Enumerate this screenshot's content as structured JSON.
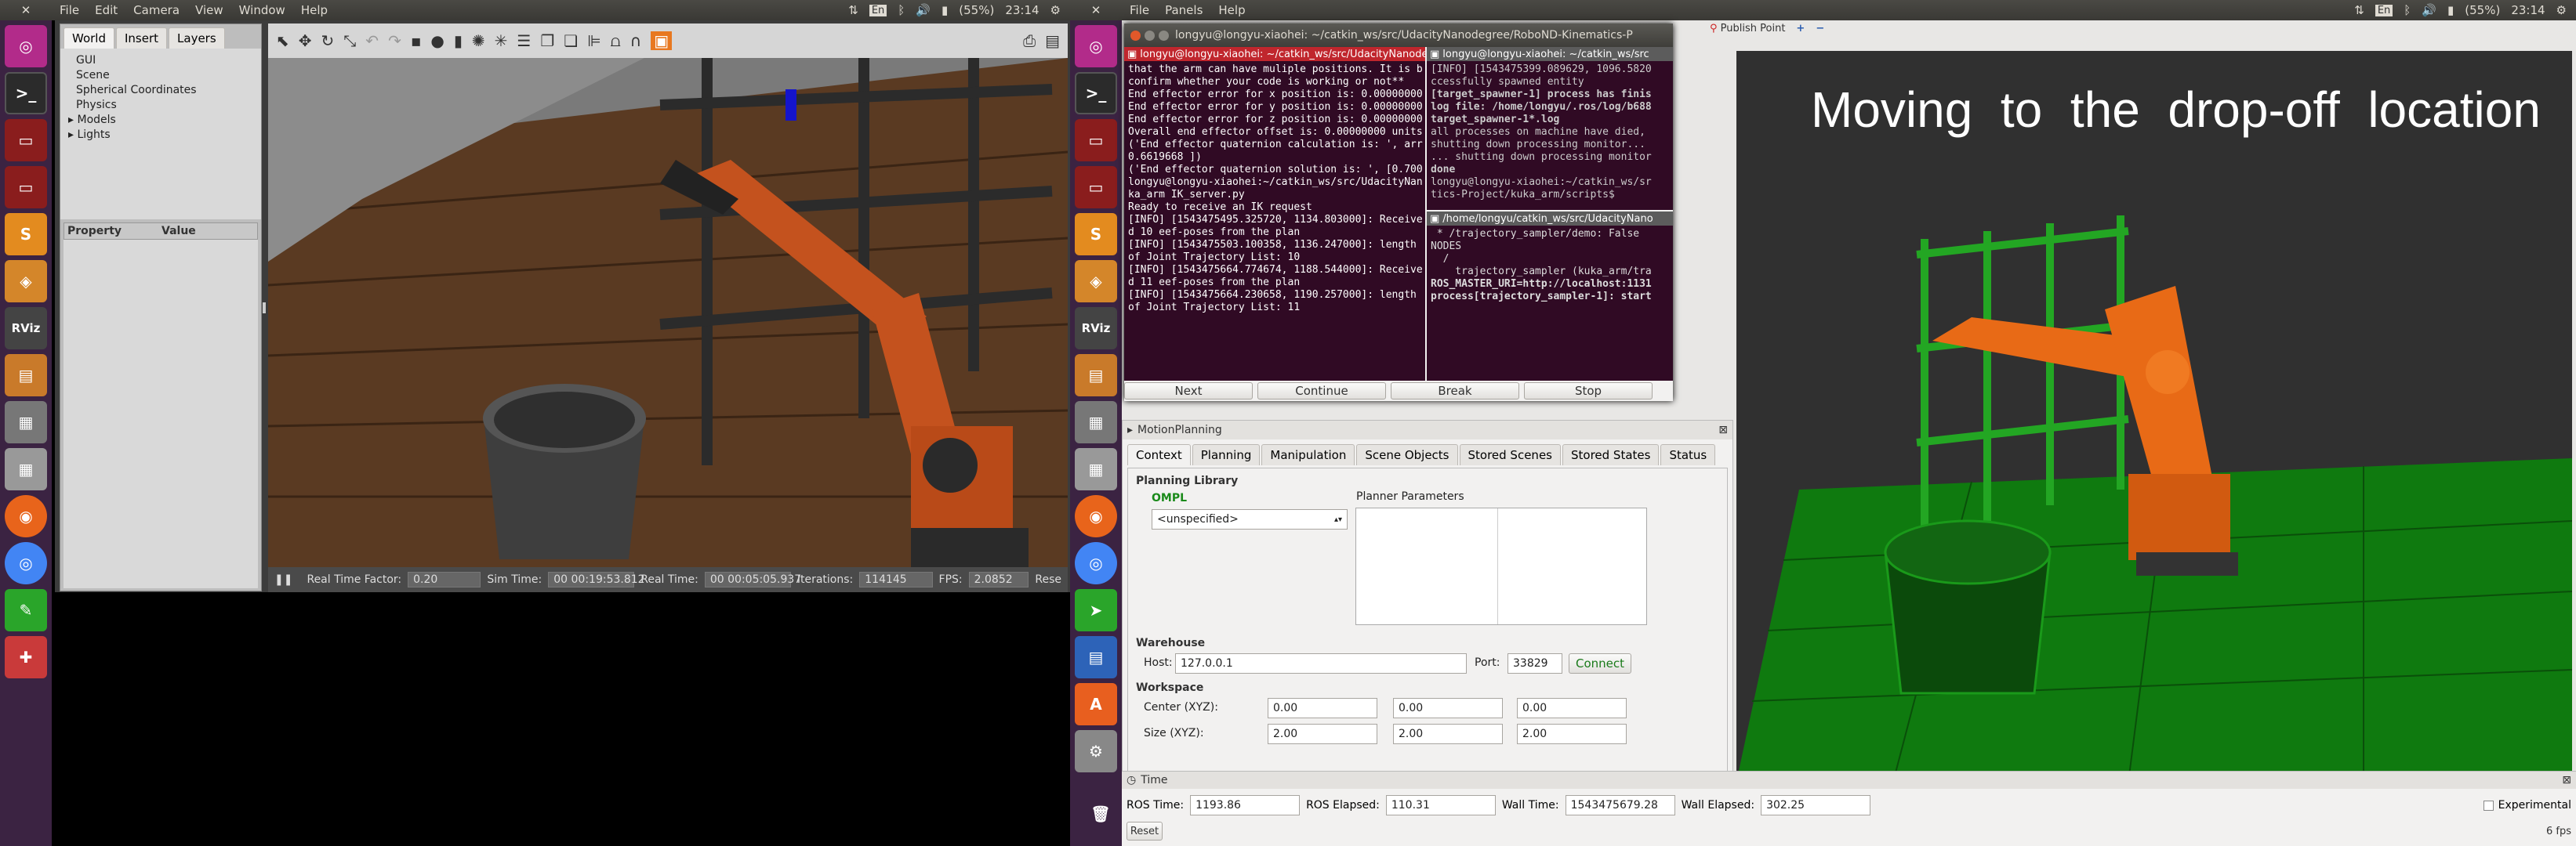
{
  "left_menubar": {
    "items": [
      "File",
      "Edit",
      "Camera",
      "View",
      "Window",
      "Help"
    ],
    "battery": "(55%)",
    "clock": "23:14",
    "kbd": "En"
  },
  "right_menubar": {
    "items": [
      "File",
      "Panels",
      "Help"
    ],
    "battery": "(55%)",
    "clock": "23:14",
    "kbd": "En"
  },
  "gazebo": {
    "tabs": [
      "World",
      "Insert",
      "Layers"
    ],
    "tree": [
      "GUI",
      "Scene",
      "Spherical Coordinates",
      "Physics",
      "Models",
      "Lights"
    ],
    "prop_header": "Property",
    "value_header": "Value",
    "status": {
      "rtf_label": "Real Time Factor:",
      "rtf": "0.20",
      "sim_label": "Sim Time:",
      "sim": "00 00:19:53.812",
      "real_label": "Real Time:",
      "real": "00 00:05:05.937",
      "iter_label": "Iterations:",
      "iter": "114145",
      "fps_label": "FPS:",
      "fps": "2.0852",
      "reset": "Rese"
    }
  },
  "terminal_main": {
    "title": "longyu@longyu-xiaohei: ~/catkin_ws/src/UdacityNanodegree/RoboND-Kinematics-P",
    "tab_title": "longyu@longyu-xiaohei: ~/catkin_ws/src/UdacityNanode",
    "lines": [
      "that the arm can have muliple positions. It is b",
      "",
      "confirm whether your code is working or not**",
      "",
      "",
      "End effector error for x position is: 0.00000000",
      "End effector error for y position is: 0.00000000",
      "End effector error for z position is: 0.00000000",
      "Overall end effector offset is: 0.00000000 units",
      "",
      "('End effector quaternion calculation is: ', arr",
      "0.6619668 ])",
      "('End effector quaternion solution is: ', [0.700",
      "longyu@longyu-xiaohei:~/catkin_ws/src/UdacityNan",
      "ka_arm IK_server.py",
      "Ready to receive an IK request",
      "[INFO] [1543475495.325720, 1134.803000]: Receive",
      "d 10 eef-poses from the plan",
      "[INFO] [1543475503.100358, 1136.247000]: length",
      "of Joint Trajectory List: 10",
      "[INFO] [1543475664.774674, 1188.544000]: Receive",
      "d 11 eef-poses from the plan",
      "[INFO] [1543475664.230658, 1190.257000]: length",
      "of Joint Trajectory List: 11"
    ]
  },
  "terminal_tr": {
    "title": "longyu@longyu-xiaohei: ~/catkin_ws/src",
    "lines": [
      "[INFO] [1543475399.089629, 1096.5820",
      "ccessfully spawned entity",
      "[target_spawner-1] process has finis",
      "log file: /home/longyu/.ros/log/b688",
      "target_spawner-1*.log",
      "all processes on machine have died,",
      "shutting down processing monitor...",
      "... shutting down processing monitor",
      "done",
      "longyu@longyu-xiaohei:~/catkin_ws/sr",
      "tics-Project/kuka_arm/scripts$"
    ]
  },
  "terminal_br": {
    "title": "/home/longyu/catkin_ws/src/UdacityNano",
    "lines": [
      " * /trajectory_sampler/demo: False",
      "",
      "NODES",
      "  /",
      "    trajectory_sampler (kuka_arm/tra",
      "",
      "ROS_MASTER_URI=http://localhost:1131",
      "",
      "process[trajectory_sampler-1]: start"
    ]
  },
  "control_buttons": [
    "Next",
    "Continue",
    "Break",
    "Stop"
  ],
  "rviz_toolbar": {
    "publish": "Publish Point",
    "plus": "+",
    "minus": "−"
  },
  "motion": {
    "title": "MotionPlanning",
    "tabs": [
      "Context",
      "Planning",
      "Manipulation",
      "Scene Objects",
      "Stored Scenes",
      "Stored States",
      "Status"
    ],
    "planning_library": "Planning Library",
    "ompl": "OMPL",
    "planner": "<unspecified>",
    "planner_params": "Planner Parameters",
    "warehouse": "Warehouse",
    "host_label": "Host:",
    "host": "127.0.0.1",
    "port_label": "Port:",
    "port": "33829",
    "connect": "Connect",
    "workspace": "Workspace",
    "center_label": "Center (XYZ):",
    "center": [
      "0.00",
      "0.00",
      "0.00"
    ],
    "size_label": "Size (XYZ):",
    "size": [
      "2.00",
      "2.00",
      "2.00"
    ]
  },
  "viewport_text": "Moving  to  the  drop-off  location",
  "time": {
    "title": "Time",
    "ros_time_label": "ROS Time:",
    "ros_time": "1193.86",
    "ros_elapsed_label": "ROS Elapsed:",
    "ros_elapsed": "110.31",
    "wall_time_label": "Wall Time:",
    "wall_time": "1543475679.28",
    "wall_elapsed_label": "Wall Elapsed:",
    "wall_elapsed": "302.25",
    "experimental": "Experimental",
    "reset": "Reset",
    "fps": "6 fps"
  }
}
